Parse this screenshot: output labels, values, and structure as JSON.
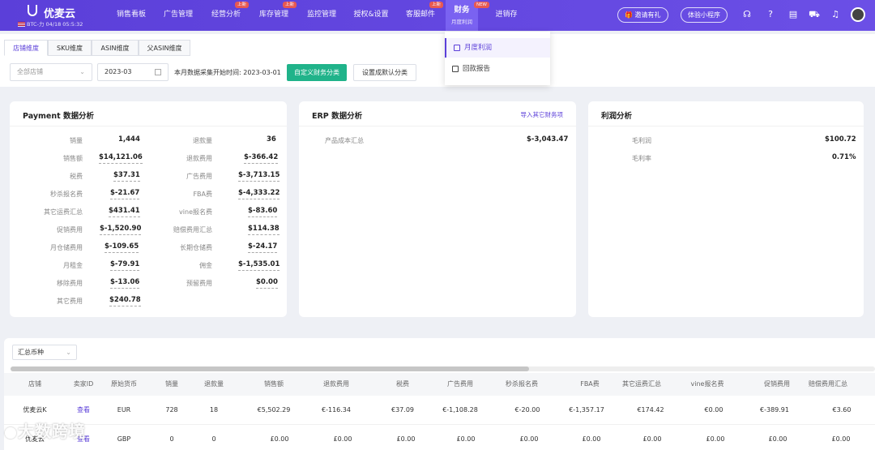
{
  "header": {
    "brand_name": "优麦云",
    "brand_sub": "BTC-力 04/18 05:5:32",
    "nav": [
      {
        "label": "销售看板",
        "badge": ""
      },
      {
        "label": "广告管理",
        "badge": ""
      },
      {
        "label": "经营分析",
        "badge": "上新"
      },
      {
        "label": "库存管理",
        "badge": "上新"
      },
      {
        "label": "监控管理",
        "badge": ""
      },
      {
        "label": "授权&设置",
        "badge": ""
      },
      {
        "label": "客服邮件",
        "badge": "上新"
      },
      {
        "label": "财务",
        "sub": "月度利润",
        "badge": "NEW"
      },
      {
        "label": "进销存",
        "badge": ""
      }
    ],
    "invite_label": "邀请有礼",
    "trial_label": "体验小程序"
  },
  "finance_menu": [
    {
      "label": "月度利润"
    },
    {
      "label": "回款报告"
    }
  ],
  "tabs": [
    "店铺维度",
    "SKU维度",
    "ASIN维度",
    "父ASIN维度"
  ],
  "filters": {
    "store_placeholder": "全部店铺",
    "month": "2023-03",
    "collect_text": "本月数据采集开始时间:",
    "collect_date": "2023-03-01",
    "custom_btn": "自定义财务分类",
    "default_btn": "设置成默认分类"
  },
  "payment": {
    "title": "Payment 数据分析",
    "left": [
      {
        "label": "销量",
        "value": "1,444",
        "plain": true
      },
      {
        "label": "销售额",
        "value": "$14,121.06"
      },
      {
        "label": "税费",
        "value": "$37.31"
      },
      {
        "label": "秒杀报名费",
        "value": "$-21.67"
      },
      {
        "label": "其它运费汇总",
        "value": "$431.41"
      },
      {
        "label": "促销费用",
        "value": "$-1,520.90"
      },
      {
        "label": "月仓储费用",
        "value": "$-109.65"
      },
      {
        "label": "月租金",
        "value": "$-79.91"
      },
      {
        "label": "移除费用",
        "value": "$-13.06"
      },
      {
        "label": "其它费用",
        "value": "$240.78"
      }
    ],
    "right": [
      {
        "label": "退款量",
        "value": "36",
        "plain": true
      },
      {
        "label": "退款费用",
        "value": "$-366.42"
      },
      {
        "label": "广告费用",
        "value": "$-3,713.15"
      },
      {
        "label": "FBA费",
        "value": "$-4,333.22"
      },
      {
        "label": "vine报名费",
        "value": "$-83.60"
      },
      {
        "label": "赔偿费用汇总",
        "value": "$114.38"
      },
      {
        "label": "长期仓储费",
        "value": "$-24.17"
      },
      {
        "label": "佣金",
        "value": "$-1,535.01"
      },
      {
        "label": "预留费用",
        "value": "$0.00"
      }
    ]
  },
  "erp": {
    "title": "ERP 数据分析",
    "link": "导入其它财务项",
    "items": [
      {
        "label": "产品成本汇总",
        "value": "$-3,043.47"
      }
    ]
  },
  "profit": {
    "title": "利润分析",
    "items": [
      {
        "label": "毛利润",
        "value": "$100.72"
      },
      {
        "label": "毛利率",
        "value": "0.71%"
      }
    ]
  },
  "table": {
    "currency_select": "汇总币种",
    "columns": [
      "店铺",
      "卖家ID",
      "原始货币",
      "销量",
      "退款量",
      "销售额",
      "退款费用",
      "税费",
      "广告费用",
      "秒杀报名费",
      "FBA费",
      "其它运费汇总",
      "vine报名费",
      "促销费用",
      "赔偿费用汇总"
    ],
    "rows": [
      [
        "优麦云K",
        "查看",
        "EUR",
        "728",
        "18",
        "€5,502.29",
        "€-116.34",
        "€37.09",
        "€-1,108.28",
        "€-20.00",
        "€-1,357.17",
        "€174.42",
        "€0.00",
        "€-389.91",
        "€3.60"
      ],
      [
        "优麦云",
        "查看",
        "GBP",
        "0",
        "0",
        "£0.00",
        "£0.00",
        "£0.00",
        "£0.00",
        "£0.00",
        "£0.00",
        "£0.00",
        "£0.00",
        "£0.00",
        "£0.00"
      ]
    ]
  },
  "watermark": "大数跨境"
}
